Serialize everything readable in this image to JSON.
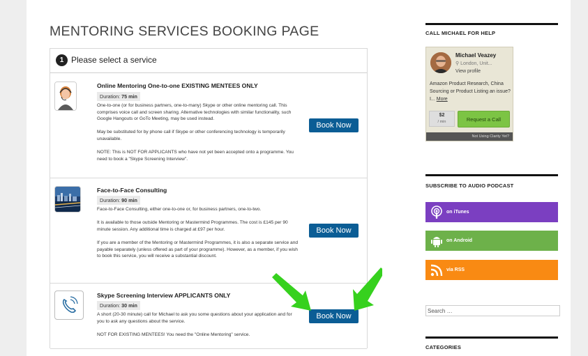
{
  "page": {
    "title": "MENTORING SERVICES BOOKING PAGE"
  },
  "step": {
    "number": "1",
    "label": "Please select a service"
  },
  "services": [
    {
      "name": "Online Mentoring One-to-one EXISTING MENTEES ONLY",
      "duration_label": "Duration:",
      "duration_value": "75 min",
      "paragraphs": [
        "One-to-one (or for business partners, one-to-many) Skype or other online mentoring call. This comprises voice call and screen sharing. Alternative technologies with similar functionality, such Google Hangouts or GoTo Meeting, may be used instead.",
        "May be substituted for by phone call if Skype or other conferencing technology is temporarily unavailable.",
        "NOTE: This is NOT FOR APPLICANTS who have not yet been accepted onto a programme. You need to book a \"Skype Screening Interview\"."
      ],
      "button": "Book Now",
      "icon": "mentor-headset-photo"
    },
    {
      "name": "Face-to-Face Consulting",
      "duration_label": "Duration:",
      "duration_value": "90 min",
      "paragraphs": [
        "Face-to-Face Consulting, either one-to-one or, for business partners, one-to-two.",
        "It is available to those outside Mentoring or Mastermind Programmes. The cost is £145 per 90 minute session. Any additional time is charged at £97 per hour.",
        "If you are a member of the Mentoring or Mastermind Programmes, it is also a separate service and payable separately (unless offered as part of your programme). However, as a member, if you wish to book this service, you will receive a substantial discount."
      ],
      "button": "Book Now",
      "icon": "city-photo"
    },
    {
      "name": "Skype Screening Interview APPLICANTS ONLY",
      "duration_label": "Duration:",
      "duration_value": "30 min",
      "paragraphs": [
        "A short (20-30 minute) call for Michael to ask you some questions about your application and for you to ask any questions about the service.",
        "NOT FOR EXISTING MENTEES! You need the \"Online Mentoring\" service."
      ],
      "button": "Book Now",
      "icon": "phone-icon"
    }
  ],
  "sidebar": {
    "help": {
      "heading": "CALL MICHAEL FOR HELP",
      "name": "Michael Veazey",
      "location": "London, Unit...",
      "profile_link": "View profile",
      "description": "Amazon Product Research, China Sourcing or Product Listing an issue? I...",
      "more": "More",
      "rate_amount": "$2",
      "rate_unit": "/ min",
      "request_button": "Request a Call",
      "footer": "Not Using Clarity Yet?"
    },
    "podcast": {
      "heading": "SUBSCRIBE TO AUDIO PODCAST",
      "buttons": [
        {
          "label": "on iTunes",
          "color": "#7b3fc1",
          "icon": "podcast-icon"
        },
        {
          "label": "on Android",
          "color": "#6db14a",
          "icon": "android-icon"
        },
        {
          "label": "via RSS",
          "color": "#f98a13",
          "icon": "rss-icon"
        }
      ]
    },
    "search": {
      "placeholder": "Search …"
    },
    "categories": {
      "heading": "CATEGORIES"
    }
  },
  "colors": {
    "book_button": "#0b5d95",
    "annotation_arrow": "#36d11e"
  }
}
